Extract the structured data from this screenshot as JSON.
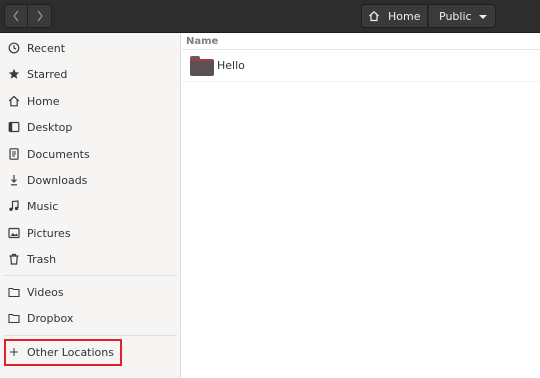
{
  "header": {
    "back_icon": "chevron-left-icon",
    "forward_icon": "chevron-right-icon",
    "path": [
      {
        "label": "Home",
        "icon": "home-icon"
      },
      {
        "label": "Public",
        "icon": "dropdown-arrow-icon"
      }
    ]
  },
  "sidebar": {
    "items": [
      {
        "label": "Recent",
        "icon": "clock-icon"
      },
      {
        "label": "Starred",
        "icon": "star-icon"
      },
      {
        "label": "Home",
        "icon": "home-icon"
      },
      {
        "label": "Desktop",
        "icon": "desktop-icon"
      },
      {
        "label": "Documents",
        "icon": "document-icon"
      },
      {
        "label": "Downloads",
        "icon": "download-icon"
      },
      {
        "label": "Music",
        "icon": "music-icon"
      },
      {
        "label": "Pictures",
        "icon": "picture-icon"
      },
      {
        "label": "Trash",
        "icon": "trash-icon"
      },
      {
        "label": "Videos",
        "icon": "folder-icon"
      },
      {
        "label": "Dropbox",
        "icon": "folder-icon"
      },
      {
        "label": "Other Locations",
        "icon": "plus-icon"
      }
    ]
  },
  "main": {
    "column_header": "Name",
    "files": [
      {
        "name": "Hello",
        "icon": "folder-icon"
      }
    ]
  },
  "colors": {
    "headerbar": "#2d2d2d",
    "sidebar": "#f6f5f4",
    "highlight": "#e0202c",
    "folder_accent": "#b0344c"
  }
}
